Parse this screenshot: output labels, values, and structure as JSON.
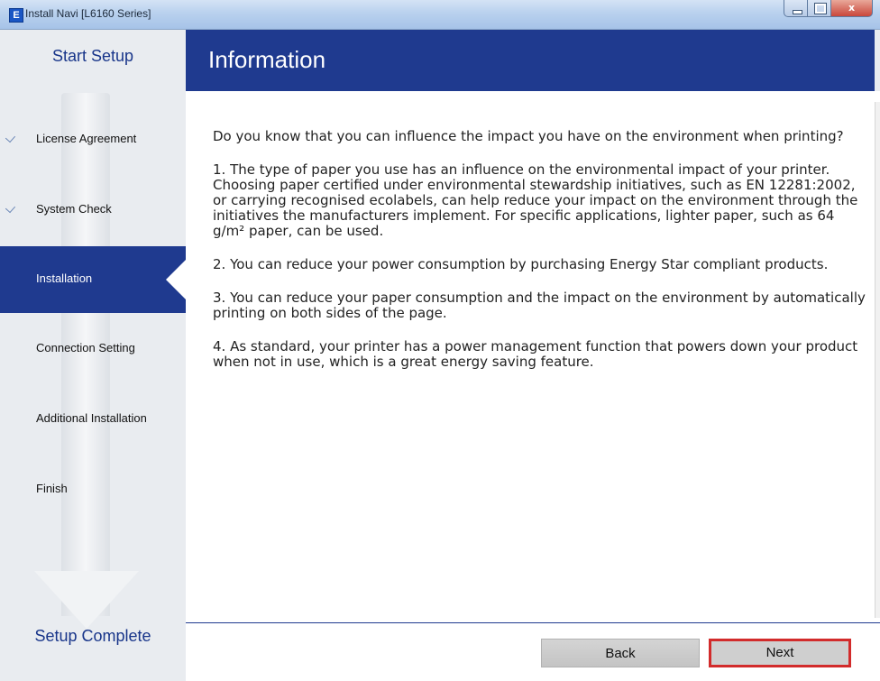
{
  "window": {
    "title": "Install Navi [L6160 Series]",
    "icon_letter": "E",
    "controls": {
      "close_glyph": "x"
    }
  },
  "sidebar": {
    "start_label": "Start Setup",
    "complete_label": "Setup Complete",
    "steps": [
      {
        "label": "License Agreement",
        "status": "done"
      },
      {
        "label": "System Check",
        "status": "done"
      },
      {
        "label": "Installation",
        "status": "current"
      },
      {
        "label": "Connection Setting",
        "status": "pending"
      },
      {
        "label": "Additional Installation",
        "status": "pending"
      },
      {
        "label": "Finish",
        "status": "pending"
      }
    ]
  },
  "header": {
    "title": "Information"
  },
  "content": {
    "paragraphs": [
      "Do you know that you can influence the impact you have on the environment when printing?",
      "1. The type of paper you use has an influence on the environmental impact of your printer. Choosing paper certified under environmental stewardship initiatives, such as EN 12281:2002, or carrying recognised ecolabels, can help reduce your impact on the environment through the initiatives the manufacturers implement. For specific applications, lighter paper, such as 64 g/m² paper, can be used.",
      "2. You can reduce your power consumption by purchasing Energy Star compliant products.",
      "3. You can reduce your paper consumption and the impact on the environment by automatically printing on both sides of the page.",
      "4. As standard, your printer has a power management function that powers down your product when not in use, which is a great energy saving feature."
    ]
  },
  "footer": {
    "back_label": "Back",
    "next_label": "Next"
  },
  "colors": {
    "brand_blue": "#1f3a8f",
    "highlight_red": "#d22b2b"
  }
}
